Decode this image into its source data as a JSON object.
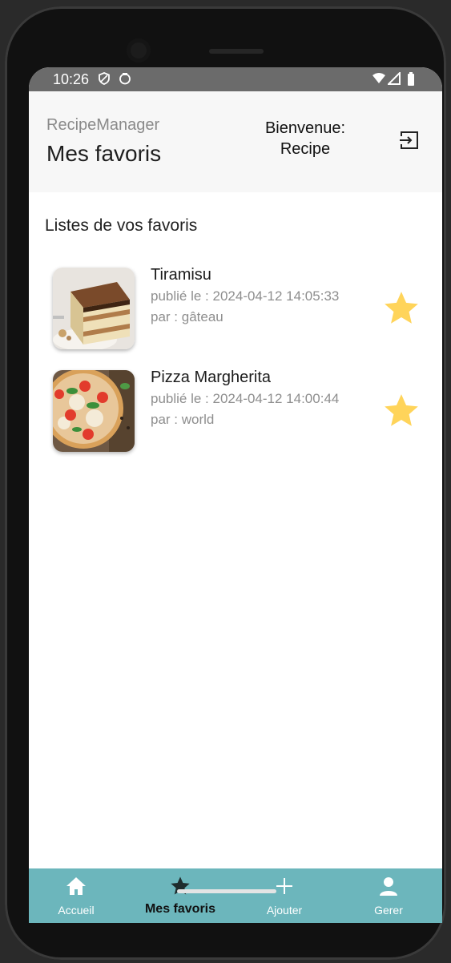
{
  "status_bar": {
    "time": "10:26",
    "icons": [
      "shield-icon",
      "sync-icon",
      "wifi-icon",
      "signal-icon",
      "battery-icon"
    ]
  },
  "header": {
    "app_name": "RecipeManager",
    "page_title": "Mes favoris",
    "welcome_line1": "Bienvenue:",
    "welcome_line2": "Recipe",
    "logout_icon": "logout-icon"
  },
  "main": {
    "section_title": "Listes de vos favoris",
    "favorites": [
      {
        "title": "Tiramisu",
        "date": "publié le : 2024-04-12 14:05:33",
        "author": "par : gâteau",
        "image": "tiramisu-image",
        "starred": true
      },
      {
        "title": "Pizza Margherita",
        "date": "publié le : 2024-04-12 14:00:44",
        "author": "par : world",
        "image": "pizza-image",
        "starred": true
      }
    ]
  },
  "bottom_nav": {
    "items": [
      {
        "label": "Accueil",
        "icon": "home-icon",
        "active": false
      },
      {
        "label": "Mes favoris",
        "icon": "star-icon",
        "active": true
      },
      {
        "label": "Ajouter",
        "icon": "plus-icon",
        "active": false
      },
      {
        "label": "Gerer",
        "icon": "person-icon",
        "active": false
      }
    ]
  },
  "colors": {
    "accent": "#6cb6bc",
    "star": "#ffd45a",
    "header_bg": "#f7f7f7",
    "status_bar": "#6b6b6b"
  }
}
